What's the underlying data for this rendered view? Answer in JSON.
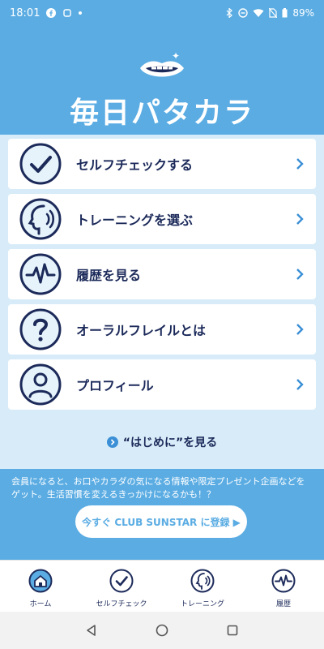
{
  "status_bar": {
    "time": "18:01",
    "battery": "89%"
  },
  "header": {
    "title": "毎日パタカラ"
  },
  "menu": {
    "items": [
      {
        "label": "セルフチェックする",
        "icon": "check-circle-icon"
      },
      {
        "label": "トレーニングを選ぶ",
        "icon": "face-voice-icon"
      },
      {
        "label": "履歴を見る",
        "icon": "pulse-icon"
      },
      {
        "label": "オーラルフレイルとは",
        "icon": "question-icon"
      },
      {
        "label": "プロフィール",
        "icon": "person-icon"
      }
    ]
  },
  "intro_link": "“はじめに”を見る",
  "promo": {
    "text": "会員になると、お口やカラダの気になる情報や限定プレゼント企画などをゲット。生活習慣を変えるきっかけになるかも！？",
    "button": "今すぐ CLUB SUNSTAR に登録 ▶"
  },
  "tabs": [
    {
      "label": "ホーム",
      "icon": "home-icon"
    },
    {
      "label": "セルフチェック",
      "icon": "check-circle-icon"
    },
    {
      "label": "トレーニング",
      "icon": "face-voice-icon"
    },
    {
      "label": "履歴",
      "icon": "pulse-icon"
    }
  ],
  "colors": {
    "brand_blue": "#5aace3",
    "navy": "#1c2a5a",
    "light_blue_bg": "#d7ecf8"
  }
}
